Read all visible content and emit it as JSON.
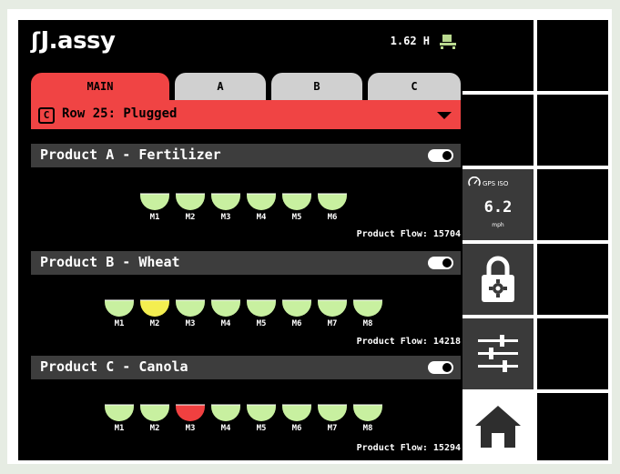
{
  "header": {
    "brand": "J.assy",
    "distance": "1.62 H"
  },
  "tabs": [
    {
      "label": "MAIN",
      "active": true
    },
    {
      "label": "A",
      "active": false
    },
    {
      "label": "B",
      "active": false
    },
    {
      "label": "C",
      "active": false
    }
  ],
  "status": {
    "badge": "C",
    "text": "Row 25: Plugged",
    "color": "#f04444"
  },
  "products": [
    {
      "title": "Product A - Fertilizer",
      "enabled": true,
      "meters": [
        {
          "label": "M1",
          "state": "ok"
        },
        {
          "label": "M2",
          "state": "ok"
        },
        {
          "label": "M3",
          "state": "ok"
        },
        {
          "label": "M4",
          "state": "ok"
        },
        {
          "label": "M5",
          "state": "ok"
        },
        {
          "label": "M6",
          "state": "ok"
        }
      ],
      "flow": "Product Flow: 15704"
    },
    {
      "title": "Product B - Wheat",
      "enabled": true,
      "meters": [
        {
          "label": "M1",
          "state": "ok"
        },
        {
          "label": "M2",
          "state": "warning"
        },
        {
          "label": "M3",
          "state": "ok"
        },
        {
          "label": "M4",
          "state": "ok"
        },
        {
          "label": "M5",
          "state": "ok"
        },
        {
          "label": "M6",
          "state": "ok"
        },
        {
          "label": "M7",
          "state": "ok"
        },
        {
          "label": "M8",
          "state": "ok"
        }
      ],
      "flow": "Product Flow: 14218"
    },
    {
      "title": "Product C - Canola",
      "enabled": true,
      "meters": [
        {
          "label": "M1",
          "state": "ok"
        },
        {
          "label": "M2",
          "state": "ok"
        },
        {
          "label": "M3",
          "state": "error"
        },
        {
          "label": "M4",
          "state": "ok"
        },
        {
          "label": "M5",
          "state": "ok"
        },
        {
          "label": "M6",
          "state": "ok"
        },
        {
          "label": "M7",
          "state": "ok"
        },
        {
          "label": "M8",
          "state": "ok"
        }
      ],
      "flow": "Product Flow: 15294"
    }
  ],
  "state_colors": {
    "ok": "#c8f0a0",
    "warning": "#f4ee50",
    "error": "#f04040"
  },
  "side_panel": {
    "gps": {
      "title": "GPS ISO",
      "value": "6.2",
      "unit": "mph"
    },
    "buttons": [
      {
        "name": "lock-settings",
        "icon": "lock-gear-icon"
      },
      {
        "name": "adjust",
        "icon": "sliders-icon"
      },
      {
        "name": "home",
        "icon": "home-icon"
      }
    ]
  }
}
